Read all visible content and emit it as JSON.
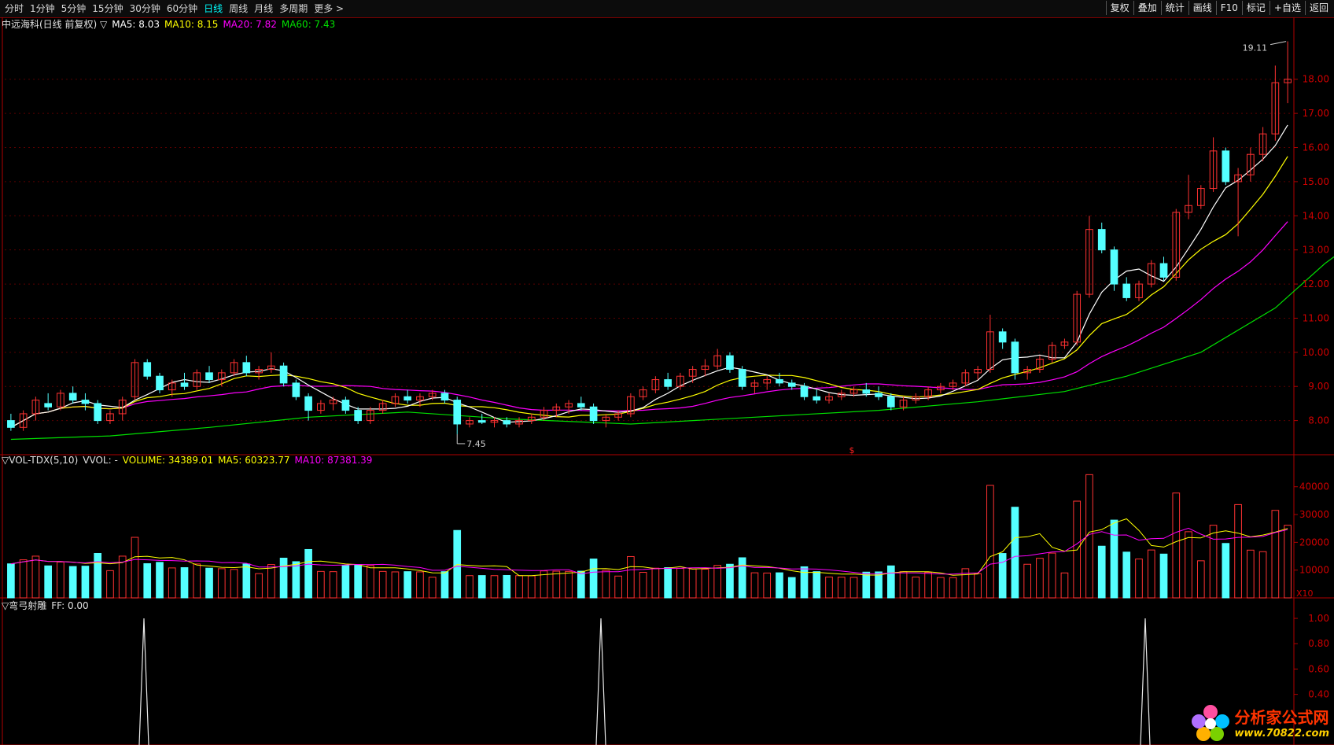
{
  "toolbar": {
    "periods": [
      "分时",
      "1分钟",
      "5分钟",
      "15分钟",
      "30分钟",
      "60分钟",
      "日线",
      "周线",
      "月线",
      "多周期",
      "更多 >"
    ],
    "active_period": "日线",
    "actions": [
      "复权",
      "叠加",
      "统计",
      "画线",
      "F10",
      "标记",
      "+自选",
      "返回"
    ]
  },
  "price_pane": {
    "title": "中远海科(日线 前复权) ▽",
    "ma5": "MA5: 8.03",
    "ma10": "MA10: 8.15",
    "ma20": "MA20: 7.82",
    "ma60": "MA60: 7.43",
    "high_label": "19.11",
    "low_label": "7.45",
    "marker": "$",
    "y_ticks": [
      "18.00",
      "17.00",
      "16.00",
      "15.00",
      "14.00",
      "13.00",
      "12.00",
      "11.00",
      "10.00",
      "9.00",
      "8.00"
    ]
  },
  "volume_pane": {
    "title": "▽VOL-TDX(5,10)",
    "vvol": "VVOL: -",
    "volume": "VOLUME: 34389.01",
    "ma5": "MA5: 60323.77",
    "ma10": "MA10: 87381.39",
    "y_ticks": [
      "40000",
      "30000",
      "20000",
      "10000"
    ],
    "multiplier": "X10"
  },
  "indicator_pane": {
    "title": "▽弯弓射雕",
    "ff": "FF: 0.00",
    "y_ticks": [
      "1.00",
      "0.80",
      "0.60",
      "0.40"
    ]
  },
  "colors": {
    "up": "#ff3232",
    "down": "#54ffff",
    "ma5": "#ffffff",
    "ma10": "#ffff00",
    "ma20": "#ff00ff",
    "ma60": "#00e000",
    "axis": "#b00000"
  },
  "chart_data": {
    "type": "candlestick",
    "price_range": [
      7.0,
      19.4
    ],
    "candles": [
      [
        8.0,
        8.2,
        7.7,
        7.8
      ],
      [
        7.8,
        8.3,
        7.7,
        8.2
      ],
      [
        8.2,
        8.7,
        8.0,
        8.6
      ],
      [
        8.5,
        8.8,
        8.3,
        8.4
      ],
      [
        8.4,
        8.9,
        8.3,
        8.8
      ],
      [
        8.8,
        9.0,
        8.5,
        8.6
      ],
      [
        8.6,
        8.8,
        8.3,
        8.5
      ],
      [
        8.5,
        8.6,
        7.9,
        8.0
      ],
      [
        8.0,
        8.3,
        7.9,
        8.2
      ],
      [
        8.2,
        8.7,
        8.0,
        8.6
      ],
      [
        8.7,
        9.8,
        8.6,
        9.7
      ],
      [
        9.7,
        9.8,
        9.2,
        9.3
      ],
      [
        9.3,
        9.4,
        8.8,
        8.9
      ],
      [
        8.9,
        9.2,
        8.7,
        9.1
      ],
      [
        9.1,
        9.4,
        8.9,
        9.0
      ],
      [
        9.0,
        9.5,
        8.9,
        9.4
      ],
      [
        9.4,
        9.6,
        9.1,
        9.2
      ],
      [
        9.2,
        9.5,
        9.0,
        9.4
      ],
      [
        9.4,
        9.8,
        9.3,
        9.7
      ],
      [
        9.7,
        9.9,
        9.3,
        9.4
      ],
      [
        9.4,
        9.6,
        9.2,
        9.5
      ],
      [
        9.5,
        10.0,
        9.4,
        9.6
      ],
      [
        9.6,
        9.7,
        9.0,
        9.1
      ],
      [
        9.1,
        9.2,
        8.6,
        8.7
      ],
      [
        8.7,
        8.8,
        8.0,
        8.3
      ],
      [
        8.3,
        8.6,
        8.2,
        8.5
      ],
      [
        8.5,
        8.7,
        8.3,
        8.6
      ],
      [
        8.6,
        8.7,
        8.2,
        8.3
      ],
      [
        8.3,
        8.4,
        7.9,
        8.0
      ],
      [
        8.0,
        8.4,
        7.9,
        8.3
      ],
      [
        8.3,
        8.6,
        8.2,
        8.5
      ],
      [
        8.5,
        8.8,
        8.4,
        8.7
      ],
      [
        8.7,
        8.9,
        8.5,
        8.6
      ],
      [
        8.6,
        8.8,
        8.4,
        8.7
      ],
      [
        8.7,
        8.9,
        8.6,
        8.8
      ],
      [
        8.8,
        8.9,
        8.5,
        8.6
      ],
      [
        8.6,
        8.7,
        7.6,
        7.9
      ],
      [
        7.9,
        8.1,
        7.8,
        8.0
      ],
      [
        8.0,
        8.2,
        7.9,
        7.95
      ],
      [
        7.95,
        8.1,
        7.8,
        8.0
      ],
      [
        8.0,
        8.1,
        7.8,
        7.9
      ],
      [
        7.9,
        8.1,
        7.8,
        8.0
      ],
      [
        8.0,
        8.2,
        7.9,
        8.1
      ],
      [
        8.1,
        8.4,
        8.0,
        8.3
      ],
      [
        8.3,
        8.5,
        8.1,
        8.4
      ],
      [
        8.4,
        8.6,
        8.2,
        8.5
      ],
      [
        8.5,
        8.7,
        8.3,
        8.4
      ],
      [
        8.4,
        8.5,
        7.9,
        8.0
      ],
      [
        8.0,
        8.2,
        7.8,
        8.1
      ],
      [
        8.1,
        8.3,
        8.0,
        8.2
      ],
      [
        8.2,
        8.8,
        8.1,
        8.7
      ],
      [
        8.7,
        9.0,
        8.6,
        8.9
      ],
      [
        8.9,
        9.3,
        8.8,
        9.2
      ],
      [
        9.2,
        9.4,
        8.9,
        9.0
      ],
      [
        9.0,
        9.4,
        8.9,
        9.3
      ],
      [
        9.3,
        9.6,
        9.1,
        9.5
      ],
      [
        9.5,
        9.8,
        9.3,
        9.6
      ],
      [
        9.6,
        10.1,
        9.5,
        9.9
      ],
      [
        9.9,
        10.0,
        9.4,
        9.5
      ],
      [
        9.5,
        9.6,
        8.9,
        9.0
      ],
      [
        9.0,
        9.2,
        8.8,
        9.1
      ],
      [
        9.1,
        9.3,
        8.9,
        9.2
      ],
      [
        9.2,
        9.4,
        9.0,
        9.1
      ],
      [
        9.1,
        9.2,
        8.9,
        9.0
      ],
      [
        9.0,
        9.1,
        8.6,
        8.7
      ],
      [
        8.7,
        8.9,
        8.5,
        8.6
      ],
      [
        8.6,
        8.8,
        8.5,
        8.7
      ],
      [
        8.7,
        8.9,
        8.6,
        8.8
      ],
      [
        8.8,
        9.0,
        8.7,
        8.9
      ],
      [
        8.9,
        9.1,
        8.7,
        8.8
      ],
      [
        8.8,
        9.0,
        8.6,
        8.7
      ],
      [
        8.7,
        8.8,
        8.3,
        8.4
      ],
      [
        8.4,
        8.7,
        8.3,
        8.6
      ],
      [
        8.6,
        8.8,
        8.5,
        8.7
      ],
      [
        8.7,
        9.0,
        8.6,
        8.9
      ],
      [
        8.9,
        9.1,
        8.8,
        9.0
      ],
      [
        9.0,
        9.2,
        8.9,
        9.1
      ],
      [
        9.1,
        9.5,
        9.0,
        9.4
      ],
      [
        9.4,
        9.6,
        9.2,
        9.5
      ],
      [
        9.5,
        11.1,
        9.4,
        10.6
      ],
      [
        10.6,
        10.7,
        10.1,
        10.3
      ],
      [
        10.3,
        10.4,
        9.2,
        9.4
      ],
      [
        9.4,
        9.6,
        9.2,
        9.5
      ],
      [
        9.5,
        9.9,
        9.4,
        9.8
      ],
      [
        9.8,
        10.3,
        9.7,
        10.2
      ],
      [
        10.2,
        10.4,
        10.1,
        10.3
      ],
      [
        10.3,
        11.8,
        10.2,
        11.7
      ],
      [
        11.7,
        14.0,
        11.6,
        13.6
      ],
      [
        13.6,
        13.8,
        12.9,
        13.0
      ],
      [
        13.0,
        13.1,
        11.8,
        12.0
      ],
      [
        12.0,
        12.2,
        11.5,
        11.6
      ],
      [
        11.6,
        12.1,
        11.5,
        12.0
      ],
      [
        12.0,
        12.7,
        11.9,
        12.6
      ],
      [
        12.6,
        12.8,
        12.1,
        12.2
      ],
      [
        12.2,
        14.2,
        12.1,
        14.1
      ],
      [
        14.1,
        15.2,
        13.9,
        14.3
      ],
      [
        14.3,
        14.9,
        14.2,
        14.8
      ],
      [
        14.8,
        16.3,
        14.7,
        15.9
      ],
      [
        15.9,
        16.0,
        14.9,
        15.0
      ],
      [
        15.0,
        15.4,
        13.4,
        15.2
      ],
      [
        15.2,
        16.0,
        15.0,
        15.8
      ],
      [
        15.8,
        16.6,
        15.6,
        16.4
      ],
      [
        16.4,
        18.4,
        16.2,
        17.9
      ],
      [
        17.9,
        19.11,
        17.3,
        18.0
      ]
    ],
    "ma60": [
      [
        0,
        7.45
      ],
      [
        8,
        7.55
      ],
      [
        16,
        7.8
      ],
      [
        24,
        8.1
      ],
      [
        32,
        8.25
      ],
      [
        40,
        8.05
      ],
      [
        50,
        7.9
      ],
      [
        60,
        8.1
      ],
      [
        70,
        8.3
      ],
      [
        78,
        8.55
      ],
      [
        85,
        8.85
      ],
      [
        90,
        9.3
      ],
      [
        96,
        10.0
      ],
      [
        102,
        11.3
      ],
      [
        106,
        12.6
      ],
      [
        109,
        13.4
      ]
    ]
  }
}
